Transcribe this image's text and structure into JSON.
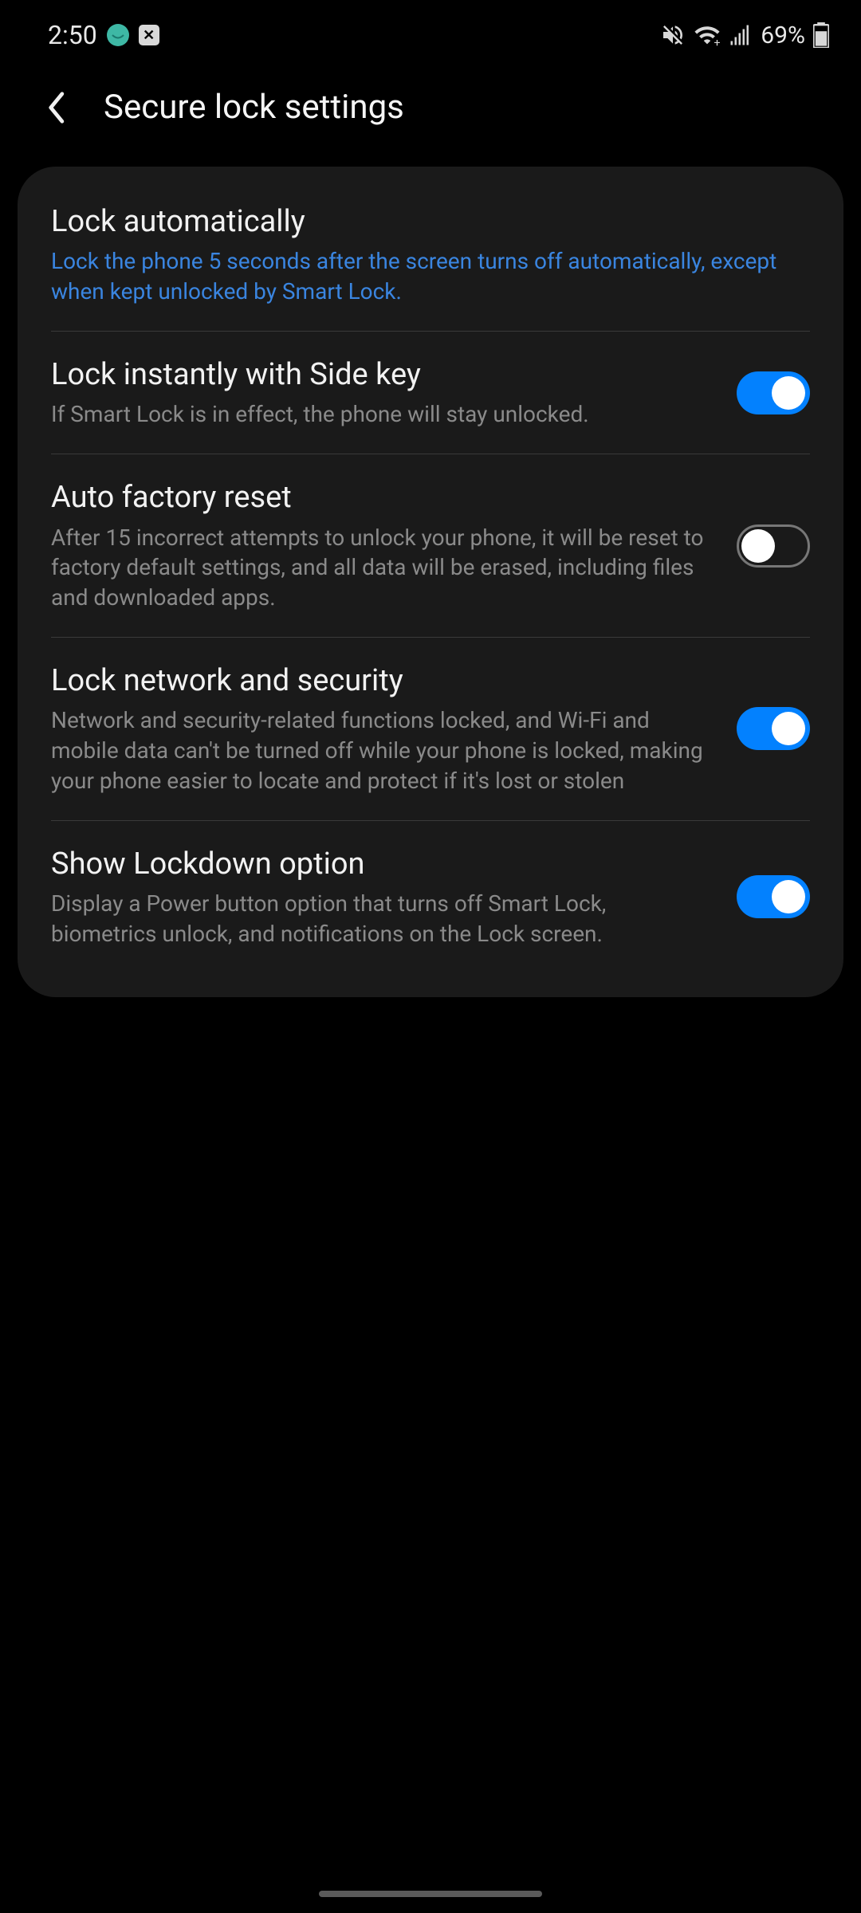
{
  "statusBar": {
    "time": "2:50",
    "battery": "69%"
  },
  "header": {
    "title": "Secure lock settings"
  },
  "settings": [
    {
      "title": "Lock automatically",
      "subtitle": "Lock the phone 5 seconds after the screen turns off automatically, except when kept unlocked by Smart Lock.",
      "subtitleAccent": true,
      "hasToggle": false
    },
    {
      "title": "Lock instantly with Side key",
      "subtitle": "If Smart Lock is in effect, the phone will stay unlocked.",
      "hasToggle": true,
      "toggleOn": true
    },
    {
      "title": "Auto factory reset",
      "subtitle": "After 15 incorrect attempts to unlock your phone, it will be reset to factory default settings, and all data will be erased, including files and downloaded apps.",
      "hasToggle": true,
      "toggleOn": false
    },
    {
      "title": "Lock network and security",
      "subtitle": "Network and security-related functions locked, and Wi-Fi and mobile data can't be turned off while your phone is locked, making your phone easier to locate and protect if it's lost or stolen",
      "hasToggle": true,
      "toggleOn": true
    },
    {
      "title": "Show Lockdown option",
      "subtitle": "Display a Power button option that turns off Smart Lock, biometrics unlock, and notifications on the Lock screen.",
      "hasToggle": true,
      "toggleOn": true
    }
  ]
}
